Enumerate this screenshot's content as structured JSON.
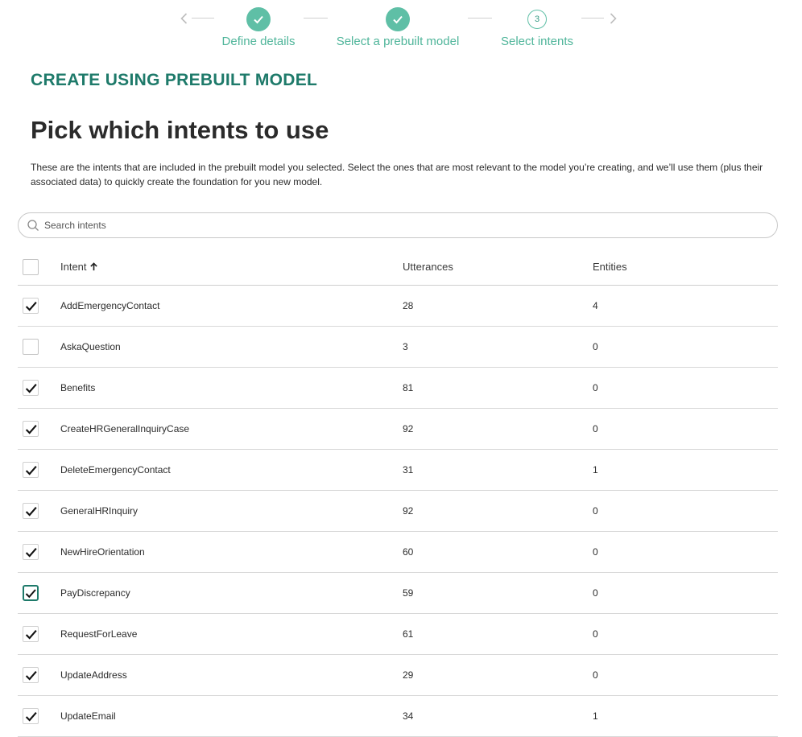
{
  "stepper": {
    "steps": [
      {
        "label": "Define details",
        "state": "done"
      },
      {
        "label": "Select a prebuilt model",
        "state": "done"
      },
      {
        "label": "Select intents",
        "state": "current",
        "number": "3"
      }
    ]
  },
  "overline": "CREATE USING PREBUILT MODEL",
  "title": "Pick which intents to use",
  "description": "These are the intents that are included in the prebuilt model you selected. Select the ones that are most relevant to the model you’re creating, and we’ll use them (plus their associated data) to quickly create the foundation for you new model.",
  "search": {
    "placeholder": "Search intents",
    "value": ""
  },
  "table": {
    "columns": {
      "intent": "Intent",
      "utterances": "Utterances",
      "entities": "Entities"
    },
    "select_all_checked": false,
    "rows": [
      {
        "intent": "AddEmergencyContact",
        "utterances": "28",
        "entities": "4",
        "checked": true
      },
      {
        "intent": "AskaQuestion",
        "utterances": "3",
        "entities": "0",
        "checked": false
      },
      {
        "intent": "Benefits",
        "utterances": "81",
        "entities": "0",
        "checked": true
      },
      {
        "intent": "CreateHRGeneralInquiryCase",
        "utterances": "92",
        "entities": "0",
        "checked": true
      },
      {
        "intent": "DeleteEmergencyContact",
        "utterances": "31",
        "entities": "1",
        "checked": true
      },
      {
        "intent": "GeneralHRInquiry",
        "utterances": "92",
        "entities": "0",
        "checked": true
      },
      {
        "intent": "NewHireOrientation",
        "utterances": "60",
        "entities": "0",
        "checked": true
      },
      {
        "intent": "PayDiscrepancy",
        "utterances": "59",
        "entities": "0",
        "checked": true,
        "focused": true
      },
      {
        "intent": "RequestForLeave",
        "utterances": "61",
        "entities": "0",
        "checked": true
      },
      {
        "intent": "UpdateAddress",
        "utterances": "29",
        "entities": "0",
        "checked": true
      },
      {
        "intent": "UpdateEmail",
        "utterances": "34",
        "entities": "1",
        "checked": true
      }
    ]
  },
  "colors": {
    "accent": "#5fbfa6",
    "heading_accent": "#1e7a6a"
  }
}
